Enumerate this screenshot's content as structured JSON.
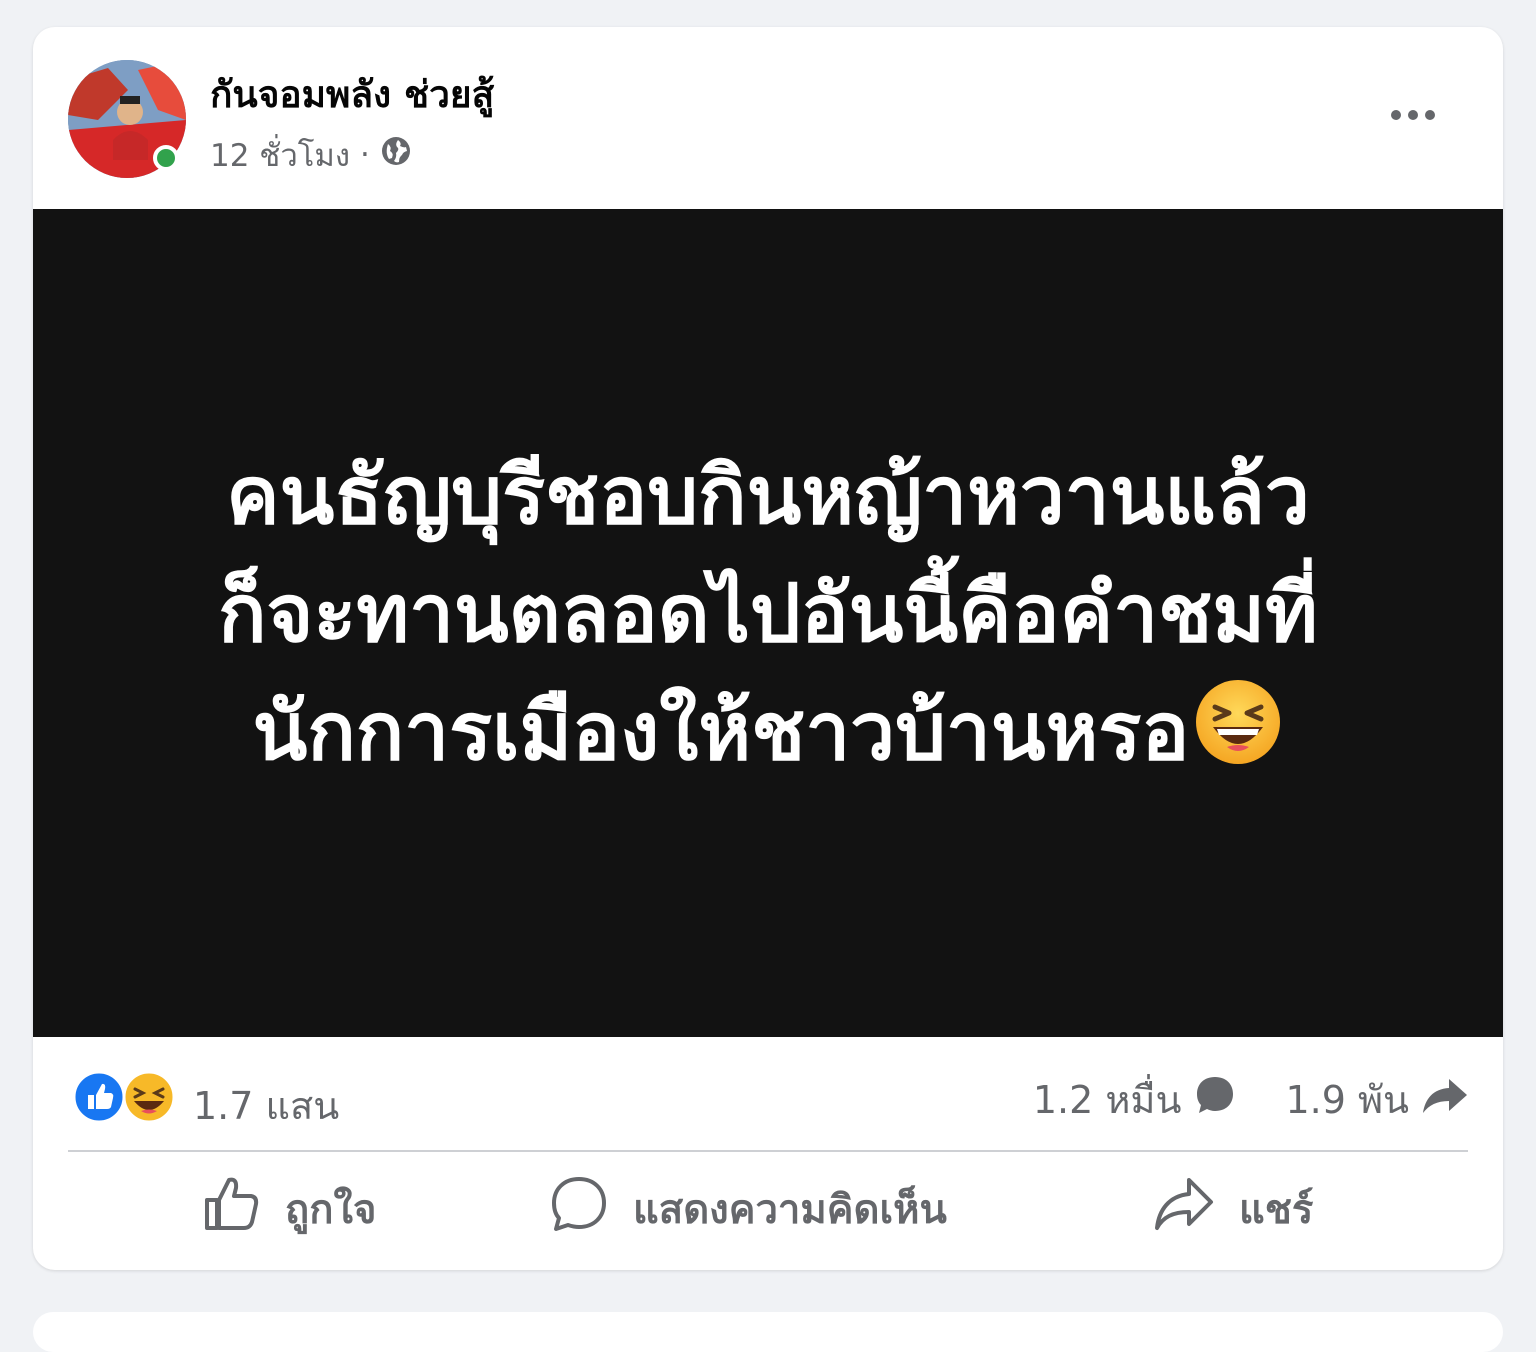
{
  "post": {
    "author": "กันจอมพลัง ช่วยสู้",
    "time": "12 ชั่วโมง",
    "separator": "·",
    "privacy_icon": "globe-icon",
    "image_text_lines": [
      "คนธัญบุรีชอบกินหญ้าหวานแล้ว",
      "ก็จะทานตลอดไปอันนี้คือคำชมที่",
      "นักการเมืองให้ชาวบ้านหรอ"
    ],
    "image_emoji": "laughing-face-icon"
  },
  "stats": {
    "reactions": "1.7 แสน",
    "reaction_icons": [
      "like-reaction-icon",
      "haha-reaction-icon"
    ],
    "comments": "1.2 หมื่น",
    "shares": "1.9 พัน"
  },
  "actions": {
    "like_label": "ถูกใจ",
    "comment_label": "แสดงความคิดเห็น",
    "share_label": "แชร์"
  },
  "colors": {
    "brand_blue": "#1877f2",
    "online_green": "#31a24c",
    "secondary_text": "#65676b",
    "image_background": "#121212"
  }
}
